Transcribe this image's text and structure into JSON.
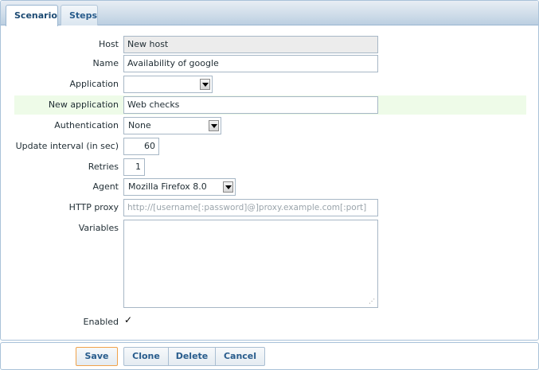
{
  "tabs": [
    {
      "label": "Scenario",
      "active": true
    },
    {
      "label": "Steps",
      "active": false
    }
  ],
  "form": {
    "host": {
      "label": "Host",
      "value": "New host"
    },
    "name": {
      "label": "Name",
      "value": "Availability of google"
    },
    "application": {
      "label": "Application",
      "value": ""
    },
    "new_application": {
      "label": "New application",
      "value": "Web checks"
    },
    "authentication": {
      "label": "Authentication",
      "value": "None"
    },
    "update_interval": {
      "label": "Update interval (in sec)",
      "value": "60"
    },
    "retries": {
      "label": "Retries",
      "value": "1"
    },
    "agent": {
      "label": "Agent",
      "value": "Mozilla Firefox 8.0"
    },
    "http_proxy": {
      "label": "HTTP proxy",
      "placeholder": "http://[username[:password]@]proxy.example.com[:port]",
      "value": ""
    },
    "variables": {
      "label": "Variables",
      "value": ""
    },
    "enabled": {
      "label": "Enabled",
      "checked": true,
      "mark": "✓"
    }
  },
  "buttons": {
    "save": "Save",
    "clone": "Clone",
    "delete": "Delete",
    "cancel": "Cancel"
  },
  "colors": {
    "tab_bar": "#bccfe1",
    "highlight_row": "#eefbe8",
    "button_text": "#285c8c",
    "save_border": "#f0a24a"
  }
}
